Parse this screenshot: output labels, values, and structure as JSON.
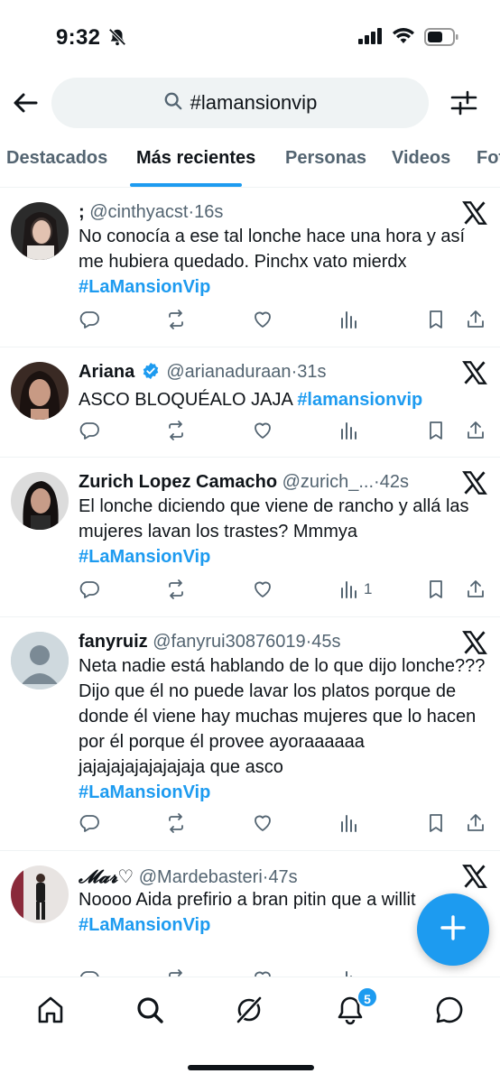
{
  "status_bar": {
    "time": "9:32"
  },
  "search": {
    "query": "#lamansionvip"
  },
  "tabs": [
    {
      "label": "Destacados"
    },
    {
      "label": "Más recientes"
    },
    {
      "label": "Personas"
    },
    {
      "label": "Videos"
    },
    {
      "label": "Fot"
    }
  ],
  "tweets": [
    {
      "name": ";",
      "handle": "@cinthyacst",
      "age": "16s",
      "text": "No conocía a ese tal lonche hace una hora y así me hubiera quedado. Pinchx vato mierdx",
      "hashtag": "#LaMansionVip",
      "views": ""
    },
    {
      "name": "Ariana",
      "handle": "@arianaduraan",
      "age": "31s",
      "text": "ASCO BLOQUÉALO JAJA",
      "hashtag": "#lamansionvip",
      "views": ""
    },
    {
      "name": "Zurich Lopez Camacho",
      "handle": "@zurich_...",
      "age": "42s",
      "text": "El lonche diciendo que viene de rancho y allá las mujeres lavan los trastes? Mmmya",
      "hashtag": "#LaMansionVip",
      "views": "1"
    },
    {
      "name": "fanyruiz",
      "handle": "@fanyrui30876019",
      "age": "45s",
      "text": "Neta nadie está hablando de lo que dijo lonche??? Dijo que él no puede lavar los platos porque de donde él viene hay muchas mujeres que lo hacen por él porque él provee ayoraaaaaa jajajajajajajajaja que asco",
      "hashtag": "#LaMansionVip",
      "views": ""
    },
    {
      "name": "𝓜𝓪𝓻♡",
      "handle": "@Mardebasteri",
      "age": "47s",
      "text": "Noooo Aida prefirio a bran pitin que a willit",
      "hashtag": "#LaMansionVip",
      "views": ""
    }
  ],
  "notifications": {
    "count": "5"
  },
  "colors": {
    "accent": "#1d9bf0",
    "text": "#0f1419",
    "muted": "#536471"
  }
}
